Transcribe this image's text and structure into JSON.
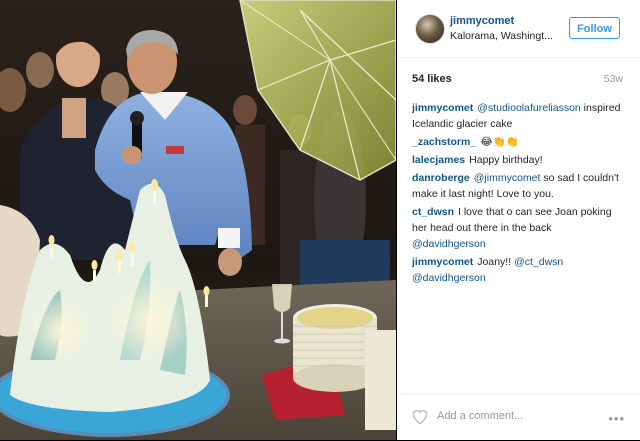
{
  "post": {
    "username": "jimmycomet",
    "location": "Kalorama, Washingt...",
    "follow_label": "Follow",
    "likes": "54 likes",
    "age": "53w"
  },
  "comments": [
    {
      "user": "jimmycomet",
      "parts": [
        {
          "t": "@studioolafureliasson",
          "m": true
        },
        {
          "t": " inspired Icelandic glacier cake",
          "m": false
        }
      ]
    },
    {
      "user": "_zachstorm_",
      "parts": [
        {
          "t": "😂👏👏",
          "m": false
        }
      ]
    },
    {
      "user": "lalecjames",
      "parts": [
        {
          "t": "Happy birthday!",
          "m": false
        }
      ]
    },
    {
      "user": "danroberge",
      "parts": [
        {
          "t": "@jimmycomet",
          "m": true
        },
        {
          "t": " so sad I couldn't make it last night! Love to you.",
          "m": false
        }
      ]
    },
    {
      "user": "ct_dwsn",
      "parts": [
        {
          "t": "I love that o can see Joan poking her head out there in the back ",
          "m": false
        },
        {
          "t": "@davidhgerson",
          "m": true
        }
      ]
    },
    {
      "user": "jimmycomet",
      "parts": [
        {
          "t": "Joany!! ",
          "m": false
        },
        {
          "t": "@ct_dwsn",
          "m": true
        },
        {
          "t": " ",
          "m": false
        },
        {
          "t": "@davidhgerson",
          "m": true
        }
      ]
    }
  ],
  "footer": {
    "add_comment_placeholder": "Add a comment...",
    "more_glyph": "•••",
    "like_icon": "heart-icon",
    "more_icon": "more-options-icon"
  },
  "colors": {
    "username_link": "#125688",
    "follow_blue": "#3897f0",
    "muted": "#999999"
  }
}
